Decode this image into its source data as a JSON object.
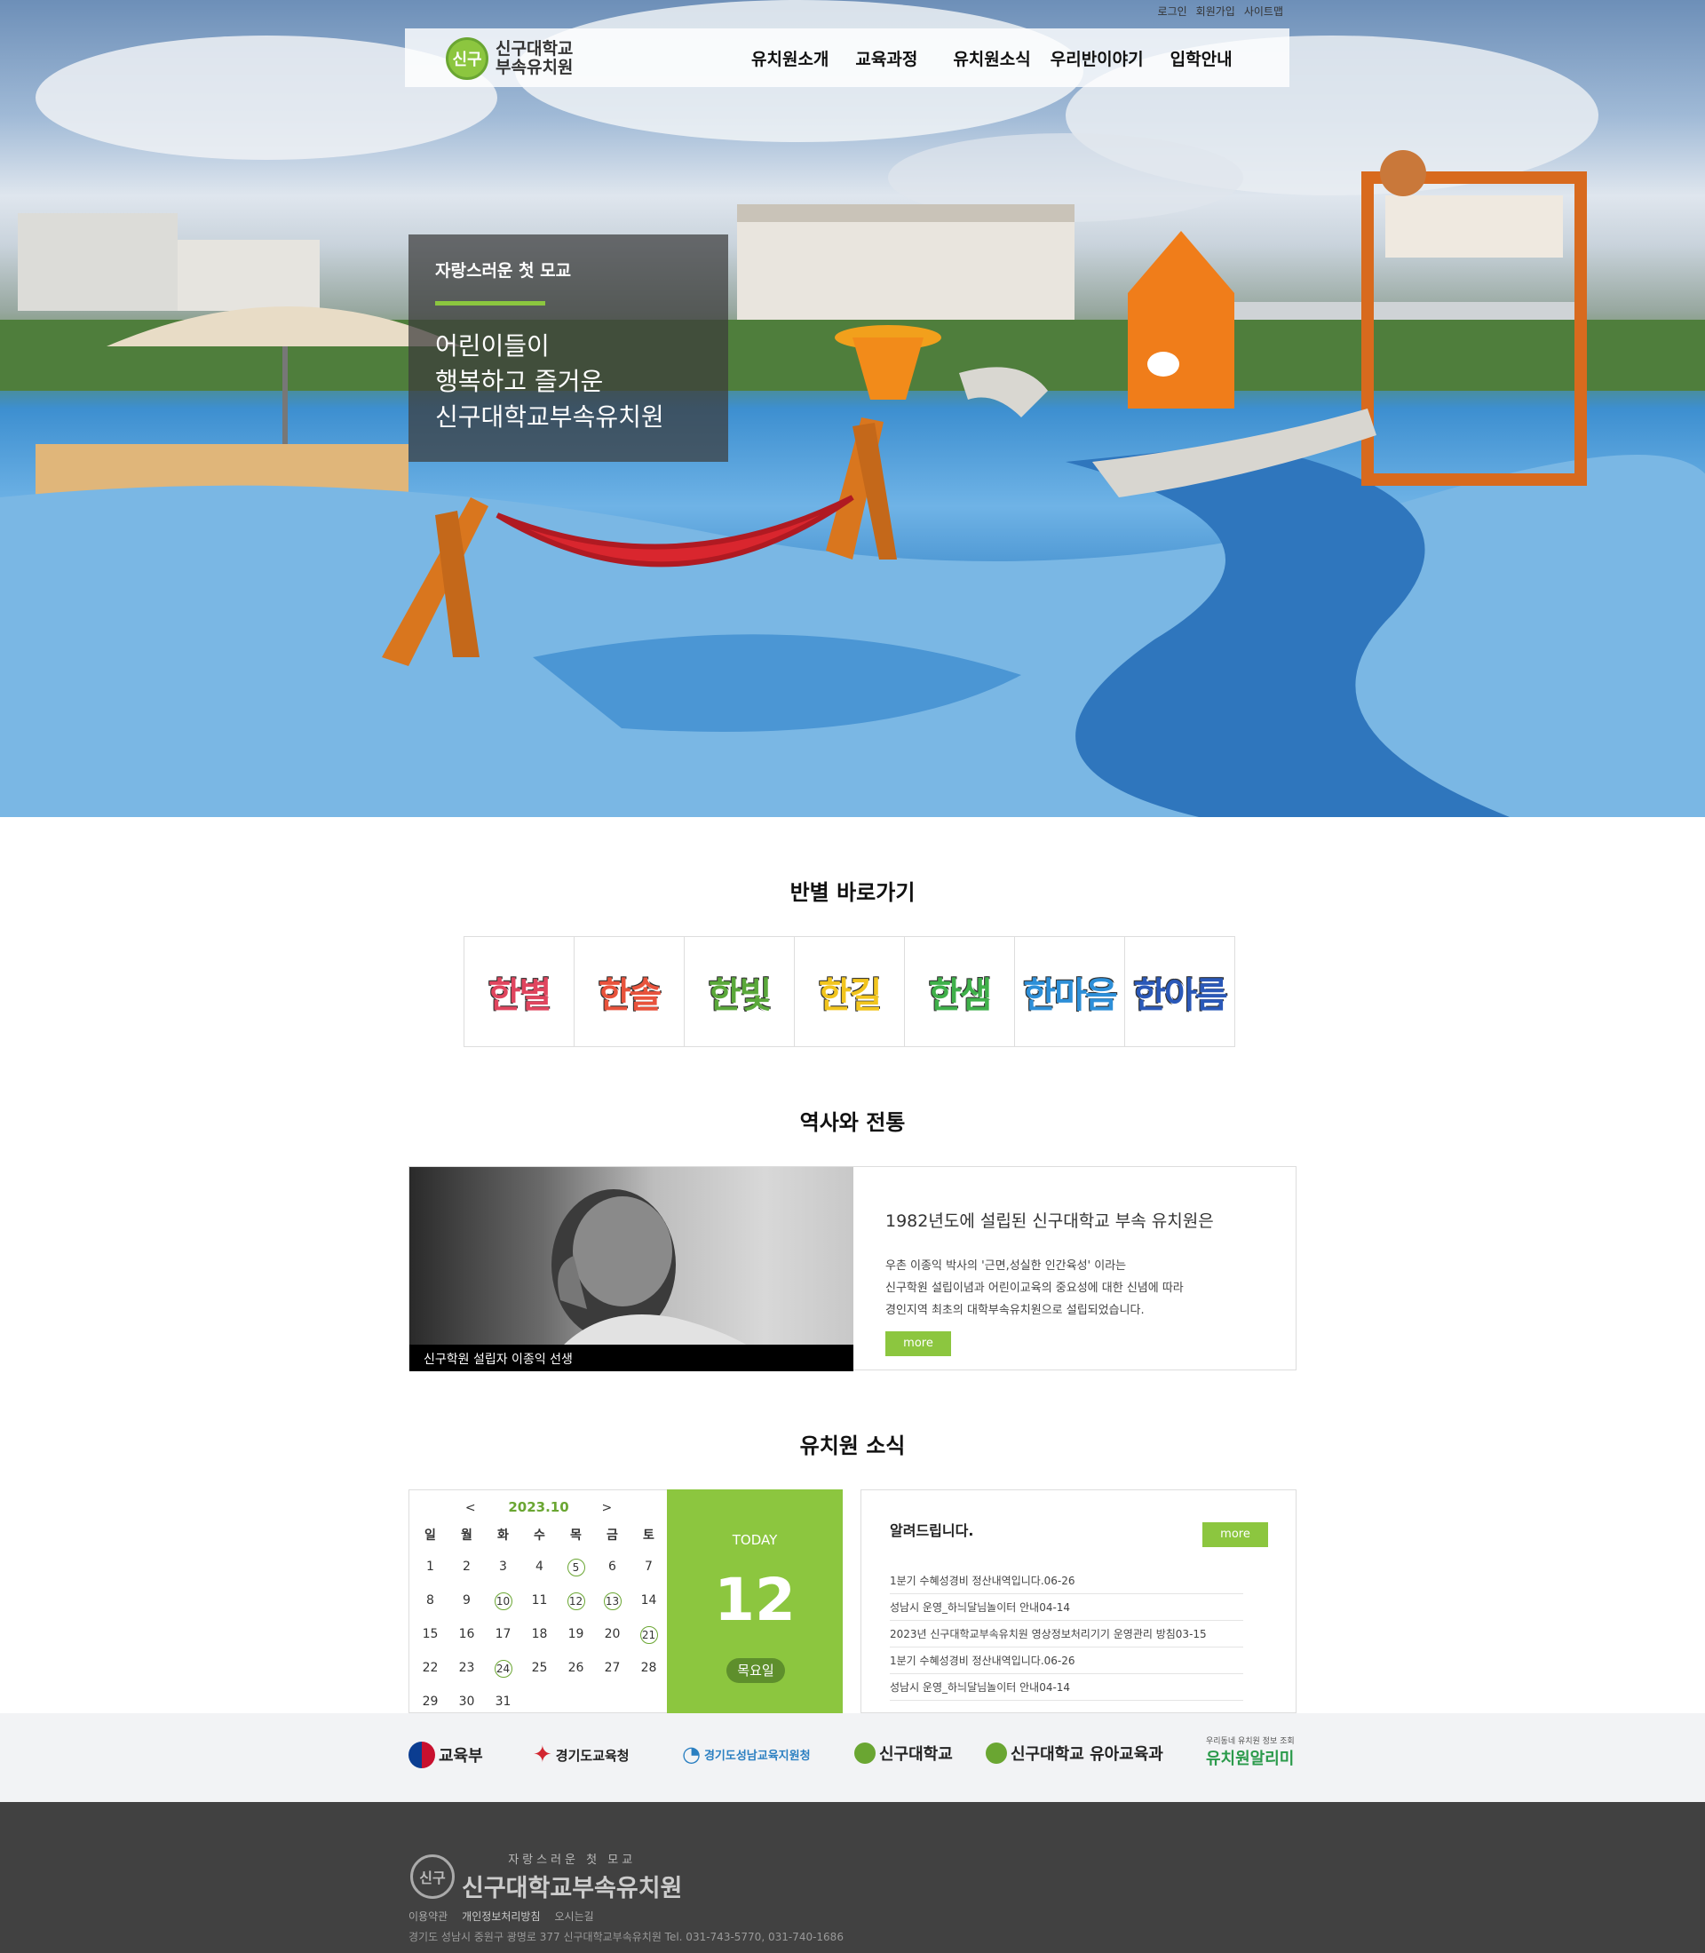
{
  "util_nav": [
    "로그인",
    "회원가입",
    "사이트맵"
  ],
  "logo": {
    "line1": "신구대학교",
    "line2": "부속유치원",
    "mark": "신구"
  },
  "gnb": [
    "유치원소개",
    "교육과정",
    "유치원소식",
    "우리반이야기",
    "입학안내"
  ],
  "hero": {
    "kicker": "자랑스러운 첫 모교",
    "slogan": "어린이들이\n행복하고 즐거운\n신구대학교부속유치원"
  },
  "classes_section": {
    "title": "반별 바로가기",
    "items": [
      {
        "label": "한별",
        "color": "#e0455e"
      },
      {
        "label": "한솔",
        "color": "#e8533c"
      },
      {
        "label": "한빛",
        "color": "#5aa83a"
      },
      {
        "label": "한길",
        "color": "#f2c51e"
      },
      {
        "label": "한샘",
        "color": "#3fb04a"
      },
      {
        "label": "한마음",
        "color": "#2d8fd8"
      },
      {
        "label": "한아름",
        "color": "#2a58b8"
      }
    ]
  },
  "history": {
    "title": "역사와 전통",
    "caption": "신구학원 설립자 이종익 선생",
    "heading": "1982년도에 설립된 신구대학교 부속 유치원은",
    "body": "우촌 이종익 박사의 '근면,성실한 인간육성' 이라는\n신구학원 설립이념과 어린이교육의 중요성에 대한 신념에 따라\n경인지역 최초의 대학부속유치원으로 설립되었습니다.",
    "more": "more"
  },
  "news": {
    "title": "유치원 소식",
    "calendar": {
      "prev": "<",
      "next": ">",
      "month_label": "2023.10",
      "weekdays": [
        "일",
        "월",
        "화",
        "수",
        "목",
        "금",
        "토"
      ],
      "weeks": [
        [
          "1",
          "2",
          "3",
          "4",
          "5",
          "6",
          "7"
        ],
        [
          "8",
          "9",
          "10",
          "11",
          "12",
          "13",
          "14"
        ],
        [
          "15",
          "16",
          "17",
          "18",
          "19",
          "20",
          "21"
        ],
        [
          "22",
          "23",
          "24",
          "25",
          "26",
          "27",
          "28"
        ],
        [
          "29",
          "30",
          "31",
          "",
          "",
          "",
          ""
        ]
      ],
      "event_days": [
        "5",
        "10",
        "12",
        "13",
        "21",
        "24"
      ]
    },
    "today": {
      "label": "TODAY",
      "day": "12",
      "weekday": "목요일"
    },
    "notice": {
      "title": "알려드립니다.",
      "more": "more",
      "items": [
        "1분기 수혜성경비 정산내역입니다.06-26",
        "성남시 운영_하늬달님놀이터 안내04-14",
        "2023년 신구대학교부속유치원 영상정보처리기기 운영관리 방침03-15",
        "1분기 수혜성경비 정산내역입니다.06-26",
        "성남시 운영_하늬달님놀이터 안내04-14"
      ]
    }
  },
  "partners": [
    {
      "label": "교육부",
      "icon": "taeguk-icon",
      "color": "#c8102e"
    },
    {
      "label": "경기도교육청",
      "icon": "gyeonggi-edu-icon",
      "color": "#d22630"
    },
    {
      "label": "경기도성남교육지원청",
      "icon": "seongnam-edu-icon",
      "color": "#2a7fc1"
    },
    {
      "label": "신구대학교",
      "icon": "shingu-icon",
      "color": "#6aa632"
    },
    {
      "label": "신구대학교 유아교육과",
      "icon": "shingu-icon",
      "color": "#6aa632"
    },
    {
      "label": "유치원알리미",
      "icon": "alimi-icon",
      "color": "#2a9a4a",
      "small": "우리동네 유치원 정보 조회"
    }
  ],
  "footer": {
    "sub": "자랑스러운 첫 모교",
    "name": "신구대학교부속유치원",
    "mark": "신구",
    "links": [
      "이용약관",
      "개인정보처리방침",
      "오시는길"
    ],
    "address": "경기도 성남시 중원구 광명로 377 신구대학교부속유치원 Tel. 031-743-5770, 031-740-1686"
  },
  "colors": {
    "accent": "#8cc63f",
    "accent_dark": "#6aa632",
    "footer_bg": "#414141"
  }
}
